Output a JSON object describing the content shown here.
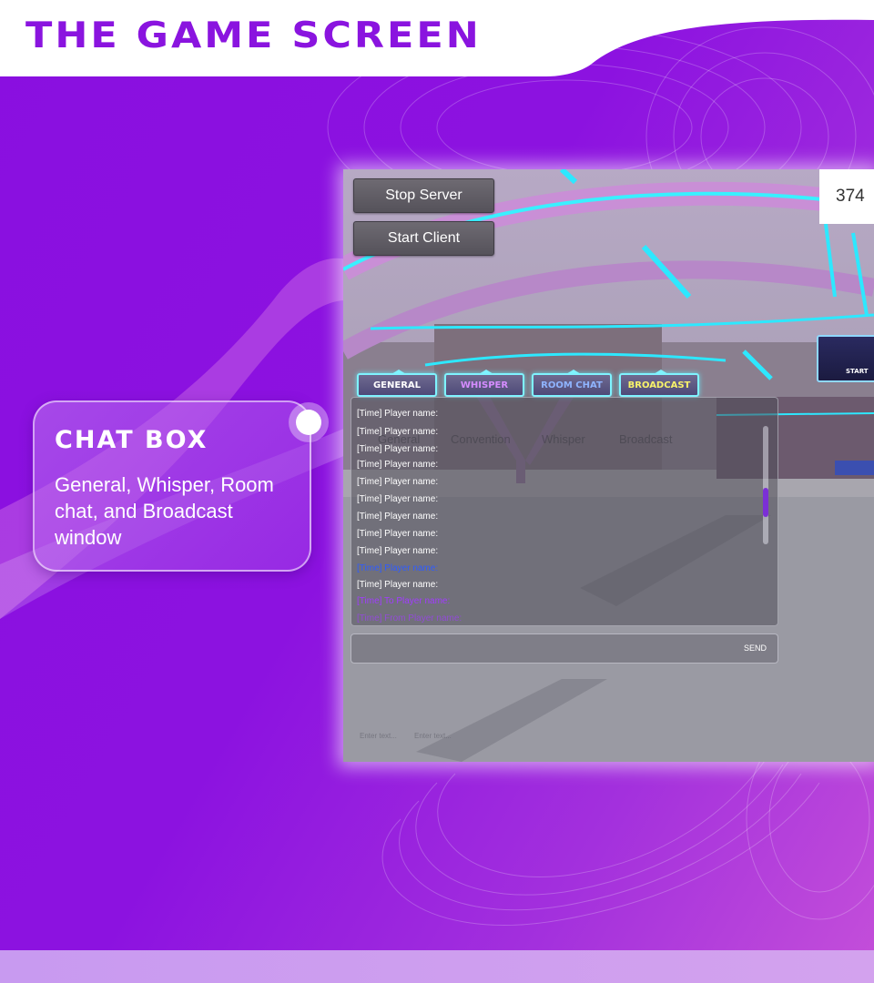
{
  "header": {
    "title": "THE GAME SCREEN"
  },
  "callout": {
    "title": "CHAT  BOX",
    "description": "General, Whisper, Room chat, and Broadcast window"
  },
  "game": {
    "buttons": {
      "stop_server": "Stop Server",
      "start_client": "Start Client"
    },
    "counter": "374",
    "tabs": [
      {
        "label": "GENERAL",
        "color": "#ffffff"
      },
      {
        "label": "WHISPER",
        "color": "#d58cff"
      },
      {
        "label": "ROOM CHAT",
        "color": "#8fb4ff"
      },
      {
        "label": "BROADCAST",
        "color": "#f8f36a"
      }
    ],
    "ghost_tabs": [
      "General",
      "Convention",
      "Whisper",
      "Broadcast"
    ],
    "chat_lines": [
      {
        "text": "[Time] Player name:",
        "color": "#ffffff"
      },
      {
        "text": "[Time] Player name:",
        "color": "#ffffff"
      },
      {
        "text": "[Time] Player name:",
        "color": "#ffffff"
      },
      {
        "text": "[Time] Player name:",
        "color": "#ffffff"
      },
      {
        "text": "[Time] Player name:",
        "color": "#ffffff"
      },
      {
        "text": "[Time] Player name:",
        "color": "#ffffff"
      },
      {
        "text": "[Time] Player name:",
        "color": "#ffffff"
      },
      {
        "text": "[Time] Player name:",
        "color": "#ffffff"
      },
      {
        "text": "[Time] Player name:",
        "color": "#ffffff"
      },
      {
        "text": "[Time] Player name:",
        "color": "#2e5bff"
      },
      {
        "text": "[Time] Player name:",
        "color": "#ffffff"
      },
      {
        "text": "[Time] To Player name:",
        "color": "#a13cff"
      },
      {
        "text": "[Time] From Player name:",
        "color": "#a13cff"
      }
    ],
    "send_label": "SEND",
    "faint_inputs": [
      "Enter text...",
      "Enter text..."
    ],
    "billboard_text": "START"
  }
}
